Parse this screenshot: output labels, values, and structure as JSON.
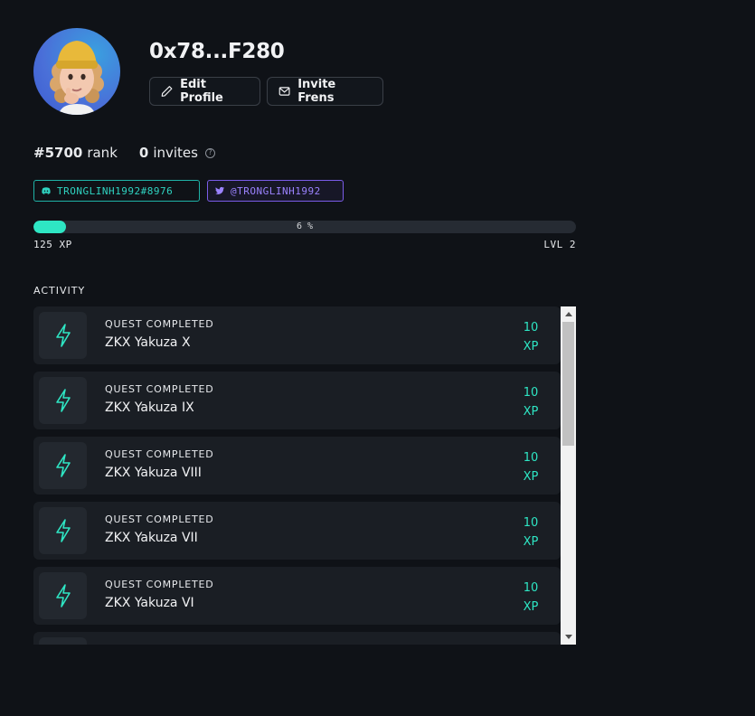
{
  "profile": {
    "wallet": "0x78...F280",
    "edit_label": "Edit Profile",
    "invite_label": "Invite Frens"
  },
  "stats": {
    "rank_value": "#5700",
    "rank_label": "rank",
    "invites_value": "0",
    "invites_label": "invites",
    "help_glyph": "?"
  },
  "socials": {
    "discord": "TRONGLINH1992#8976",
    "twitter": "@TRONGLINH1992"
  },
  "progress": {
    "percent": 6,
    "label": "6 %",
    "xp_text": "125 XP",
    "level_text": "LVL 2"
  },
  "activity": {
    "title": "ACTIVITY",
    "items": [
      {
        "kind": "QUEST COMPLETED",
        "name": "ZKX Yakuza X",
        "xp": "10",
        "unit": "XP"
      },
      {
        "kind": "QUEST COMPLETED",
        "name": "ZKX Yakuza IX",
        "xp": "10",
        "unit": "XP"
      },
      {
        "kind": "QUEST COMPLETED",
        "name": "ZKX Yakuza VIII",
        "xp": "10",
        "unit": "XP"
      },
      {
        "kind": "QUEST COMPLETED",
        "name": "ZKX Yakuza VII",
        "xp": "10",
        "unit": "XP"
      },
      {
        "kind": "QUEST COMPLETED",
        "name": "ZKX Yakuza VI",
        "xp": "10",
        "unit": "XP"
      }
    ]
  },
  "colors": {
    "accent": "#2ee6c4",
    "discord": "#2fd3c1",
    "twitter": "#9b83ff",
    "background": "#0f1217",
    "card": "#1a1e24"
  },
  "icons": {
    "avatar": "memoji-avatar",
    "edit": "pencil-icon",
    "invite": "mail-icon",
    "help": "question-circle-icon",
    "discord": "discord-icon",
    "twitter": "twitter-icon",
    "quest": "lightning-bolt-icon"
  }
}
